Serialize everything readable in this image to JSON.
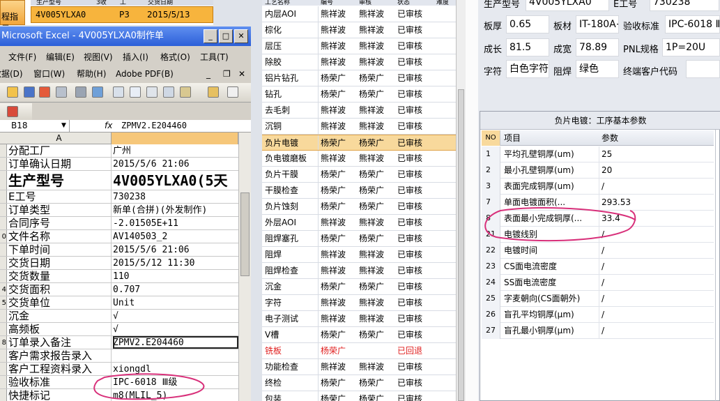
{
  "top_left": {
    "button_label": "程指示",
    "header_labels": [
      "生产型号",
      "3收",
      "工",
      "交货日期"
    ],
    "row": {
      "model": "4V005YLXA0",
      "code": "P3",
      "date": "2015/5/13"
    }
  },
  "excel": {
    "title": "Microsoft Excel - 4V005YLXA0制作单",
    "menu1": [
      "文件(F)",
      "编辑(E)",
      "视图(V)",
      "插入(I)",
      "格式(O)",
      "工具(T)"
    ],
    "menu2": [
      "数据(D)",
      "窗口(W)",
      "帮助(H)",
      "Adobe PDF(B)"
    ],
    "name_box": "B18",
    "fx": "fx",
    "formula": "ZPMV2.E204460",
    "col_a": "A",
    "rows": [
      {
        "num": "",
        "a": "分配工厂",
        "b": "广州"
      },
      {
        "num": "",
        "a": "订单确认日期",
        "b": "2015/5/6 21:06"
      },
      {
        "num": "",
        "a": "生产型号",
        "b": "4V005YLXA0(5天"
      },
      {
        "num": "",
        "a": "E工号",
        "b": "730238"
      },
      {
        "num": "",
        "a": "订单类型",
        "b": "新单(合拼)(外发制作)"
      },
      {
        "num": "",
        "a": "合同序号",
        "b": "-2.01505E+11"
      },
      {
        "num": "0",
        "a": "文件名称",
        "b": "AV140503_2"
      },
      {
        "num": "",
        "a": "下单时间",
        "b": "2015/5/6 21:06"
      },
      {
        "num": "",
        "a": "交货日期",
        "b": "2015/5/12 11:30"
      },
      {
        "num": "",
        "a": "交货数量",
        "b": "110"
      },
      {
        "num": "4",
        "a": "交货面积",
        "b": "0.707"
      },
      {
        "num": "5",
        "a": "交货单位",
        "b": "Unit"
      },
      {
        "num": "",
        "a": "沉金",
        "b": "√"
      },
      {
        "num": "",
        "a": "高频板",
        "b": "√"
      },
      {
        "num": "8",
        "a": "订单录入备注",
        "b": "ZPMV2.E204460"
      },
      {
        "num": "",
        "a": "客户需求报告录入",
        "b": ""
      },
      {
        "num": "",
        "a": "客户工程资料录入",
        "b": "xiongdl"
      },
      {
        "num": "",
        "a": "验收标准",
        "b": "IPC-6018 Ⅲ级"
      },
      {
        "num": "",
        "a": "快捷标记",
        "b": "m8(MLIL_5)"
      }
    ]
  },
  "process": {
    "headers": [
      "工艺名称",
      "编号",
      "审核",
      "状态",
      "难度"
    ],
    "rows": [
      {
        "name": "内层AOI",
        "p1": "熊祥波",
        "p2": "熊祥波",
        "status": "已审核"
      },
      {
        "name": "棕化",
        "p1": "熊祥波",
        "p2": "熊祥波",
        "status": "已审核"
      },
      {
        "name": "层压",
        "p1": "熊祥波",
        "p2": "熊祥波",
        "status": "已审核"
      },
      {
        "name": "除胶",
        "p1": "熊祥波",
        "p2": "熊祥波",
        "status": "已审核"
      },
      {
        "name": "铝片钻孔",
        "p1": "杨荣广",
        "p2": "杨荣广",
        "status": "已审核"
      },
      {
        "name": "钻孔",
        "p1": "杨荣广",
        "p2": "杨荣广",
        "status": "已审核"
      },
      {
        "name": "去毛刺",
        "p1": "熊祥波",
        "p2": "熊祥波",
        "status": "已审核"
      },
      {
        "name": "沉铜",
        "p1": "熊祥波",
        "p2": "熊祥波",
        "status": "已审核"
      },
      {
        "name": "负片电镀",
        "p1": "杨荣广",
        "p2": "杨荣广",
        "status": "已审核",
        "selected": true
      },
      {
        "name": "负电镀磨板",
        "p1": "熊祥波",
        "p2": "熊祥波",
        "status": "已审核"
      },
      {
        "name": "负片干膜",
        "p1": "杨荣广",
        "p2": "杨荣广",
        "status": "已审核"
      },
      {
        "name": "干膜检查",
        "p1": "杨荣广",
        "p2": "杨荣广",
        "status": "已审核"
      },
      {
        "name": "负片蚀刻",
        "p1": "杨荣广",
        "p2": "杨荣广",
        "status": "已审核"
      },
      {
        "name": "外层AOI",
        "p1": "熊祥波",
        "p2": "熊祥波",
        "status": "已审核"
      },
      {
        "name": "阻焊塞孔",
        "p1": "杨荣广",
        "p2": "杨荣广",
        "status": "已审核"
      },
      {
        "name": "阻焊",
        "p1": "熊祥波",
        "p2": "熊祥波",
        "status": "已审核"
      },
      {
        "name": "阻焊检查",
        "p1": "熊祥波",
        "p2": "熊祥波",
        "status": "已审核"
      },
      {
        "name": "沉金",
        "p1": "杨荣广",
        "p2": "杨荣广",
        "status": "已审核"
      },
      {
        "name": "字符",
        "p1": "熊祥波",
        "p2": "熊祥波",
        "status": "已审核"
      },
      {
        "name": "电子测试",
        "p1": "熊祥波",
        "p2": "熊祥波",
        "status": "已审核"
      },
      {
        "name": "V槽",
        "p1": "杨荣广",
        "p2": "杨荣广",
        "status": "已审核"
      },
      {
        "name": "铣板",
        "p1": "杨荣广",
        "p2": "",
        "status": "已回退",
        "red": true
      },
      {
        "name": "功能检查",
        "p1": "熊祥波",
        "p2": "熊祥波",
        "status": "已审核"
      },
      {
        "name": "终检",
        "p1": "杨荣广",
        "p2": "杨荣广",
        "status": "已审核"
      },
      {
        "name": "包装",
        "p1": "杨荣广",
        "p2": "杨荣广",
        "status": "已审核"
      }
    ]
  },
  "info": {
    "model_label": "生产型号",
    "model": "4V005YLXA0",
    "eno_label": "E工号",
    "eno": "730238",
    "thickness_label": "板厚",
    "thickness": "0.65",
    "material_label": "板材",
    "material": "IT-180A+",
    "standard_label": "验收标准",
    "standard": "IPC-6018 Ⅲ",
    "length_label": "成长",
    "length": "81.5",
    "width_label": "成宽",
    "width": "78.89",
    "pnl_label": "PNL规格",
    "pnl": "1P=20U",
    "text_label": "字符",
    "text": "白色字符",
    "mask_label": "阻焊",
    "mask": "绿色",
    "customer_label": "终端客户代码",
    "customer": ""
  },
  "params": {
    "title": "负片电镀：工序基本参数",
    "col_no": "NO",
    "col_item": "项目",
    "col_value": "参数",
    "rows": [
      {
        "no": "1",
        "item": "平均孔壁铜厚(um)",
        "value": "25"
      },
      {
        "no": "2",
        "item": "最小孔壁铜厚(um)",
        "value": "20"
      },
      {
        "no": "3",
        "item": "表面完成铜厚(um)",
        "value": "/"
      },
      {
        "no": "7",
        "item": "单面电镀面积(...",
        "value": "293.53"
      },
      {
        "no": "8",
        "item": "表面最小完成铜厚(...",
        "value": "33.4"
      },
      {
        "no": "21",
        "item": "电镀线别",
        "value": "/"
      },
      {
        "no": "22",
        "item": "电镀时间",
        "value": "/"
      },
      {
        "no": "23",
        "item": "CS面电流密度",
        "value": "/"
      },
      {
        "no": "24",
        "item": "SS面电流密度",
        "value": "/"
      },
      {
        "no": "25",
        "item": "字麦朝向(CS面朝外)",
        "value": "/"
      },
      {
        "no": "26",
        "item": "盲孔平均铜厚(μm)",
        "value": "/"
      },
      {
        "no": "27",
        "item": "盲孔最小铜厚(μm)",
        "value": "/"
      }
    ]
  },
  "annotation_color": "#d8307a"
}
